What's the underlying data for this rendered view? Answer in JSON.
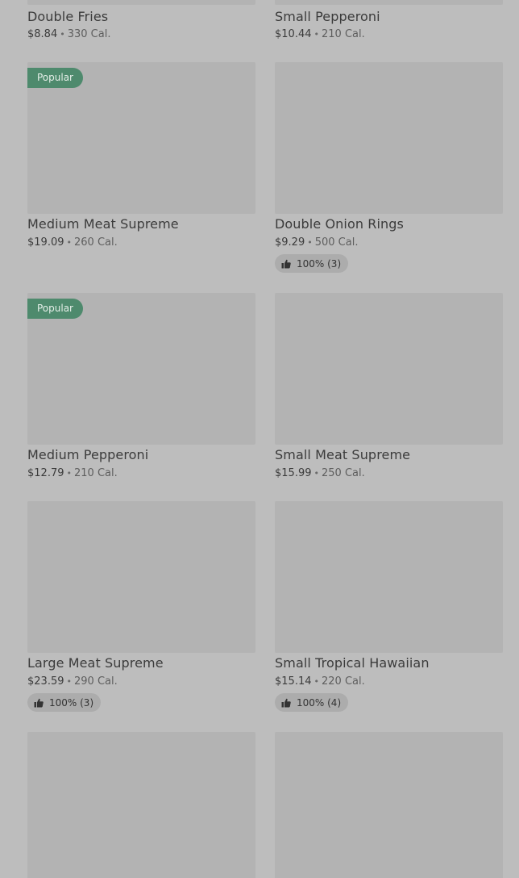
{
  "items": [
    {
      "name": "Double Fries",
      "price": "$8.84",
      "calories": "330 Cal."
    },
    {
      "name": "Small Pepperoni",
      "price": "$10.44",
      "calories": "210 Cal."
    },
    {
      "name": "Medium Meat Supreme",
      "price": "$19.09",
      "calories": "260 Cal.",
      "badge": "Popular"
    },
    {
      "name": "Double Onion Rings",
      "price": "$9.29",
      "calories": "500 Cal.",
      "rating": "100% (3)"
    },
    {
      "name": "Medium Pepperoni",
      "price": "$12.79",
      "calories": "210 Cal.",
      "badge": "Popular"
    },
    {
      "name": "Small Meat Supreme",
      "price": "$15.99",
      "calories": "250 Cal."
    },
    {
      "name": "Large Meat Supreme",
      "price": "$23.59",
      "calories": "290 Cal.",
      "rating": "100% (3)"
    },
    {
      "name": "Small Tropical Hawaiian",
      "price": "$15.14",
      "calories": "220 Cal.",
      "rating": "100% (4)"
    }
  ],
  "separator": "•",
  "icons": {
    "rating": "thumbs-up-icon"
  },
  "colors": {
    "badge": "#4e8a6d",
    "overlay_bg": "#bdbdbd",
    "thumb": "#b3b3b3"
  }
}
